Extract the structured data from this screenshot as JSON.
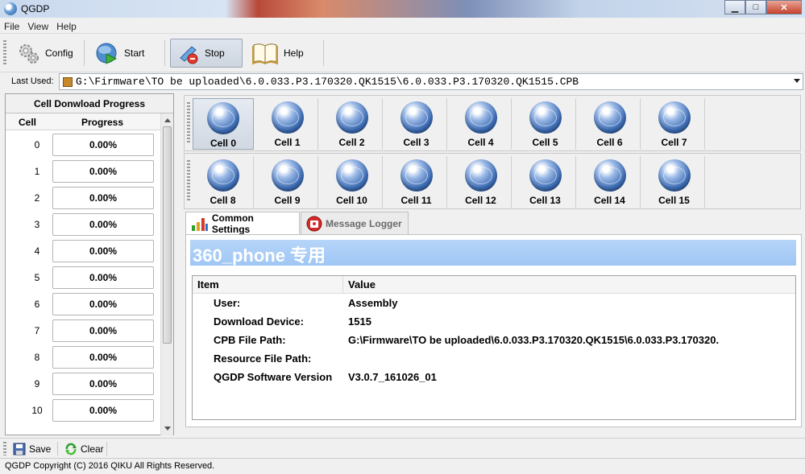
{
  "window": {
    "title": "QGDP"
  },
  "menu": [
    "File",
    "View",
    "Help"
  ],
  "toolbar": {
    "config_label": "Config",
    "start_label": "Start",
    "stop_label": "Stop",
    "help_label": "Help"
  },
  "last_used": {
    "label": "Last Used:",
    "value": "G:\\Firmware\\TO be uploaded\\6.0.033.P3.170320.QK1515\\6.0.033.P3.170320.QK1515.CPB"
  },
  "progress_panel": {
    "title": "Cell Donwload Progress",
    "col_cell": "Cell",
    "col_progress": "Progress",
    "rows": [
      {
        "cell": "0",
        "progress": "0.00%"
      },
      {
        "cell": "1",
        "progress": "0.00%"
      },
      {
        "cell": "2",
        "progress": "0.00%"
      },
      {
        "cell": "3",
        "progress": "0.00%"
      },
      {
        "cell": "4",
        "progress": "0.00%"
      },
      {
        "cell": "5",
        "progress": "0.00%"
      },
      {
        "cell": "6",
        "progress": "0.00%"
      },
      {
        "cell": "7",
        "progress": "0.00%"
      },
      {
        "cell": "8",
        "progress": "0.00%"
      },
      {
        "cell": "9",
        "progress": "0.00%"
      },
      {
        "cell": "10",
        "progress": "0.00%"
      }
    ]
  },
  "cells": {
    "row1": [
      "Cell 0",
      "Cell 1",
      "Cell 2",
      "Cell 3",
      "Cell 4",
      "Cell 5",
      "Cell 6",
      "Cell 7"
    ],
    "row2": [
      "Cell 8",
      "Cell 9",
      "Cell 10",
      "Cell 11",
      "Cell 12",
      "Cell 13",
      "Cell 14",
      "Cell 15"
    ]
  },
  "tabs": {
    "common_settings": "Common Settings",
    "message_logger": "Message Logger"
  },
  "settings": {
    "banner": "360_phone 专用",
    "col_item": "Item",
    "col_value": "Value",
    "rows": [
      {
        "item": "User:",
        "value": "Assembly"
      },
      {
        "item": "Download Device:",
        "value": "1515"
      },
      {
        "item": "CPB File Path:",
        "value": "G:\\Firmware\\TO be uploaded\\6.0.033.P3.170320.QK1515\\6.0.033.P3.170320."
      },
      {
        "item": "Resource File Path:",
        "value": ""
      },
      {
        "item": "QGDP Software Version",
        "value": "V3.0.7_161026_01"
      }
    ]
  },
  "bottom": {
    "save_label": "Save",
    "clear_label": "Clear"
  },
  "status": {
    "text": "QGDP Copyright (C) 2016 QIKU All Rights Reserved."
  }
}
